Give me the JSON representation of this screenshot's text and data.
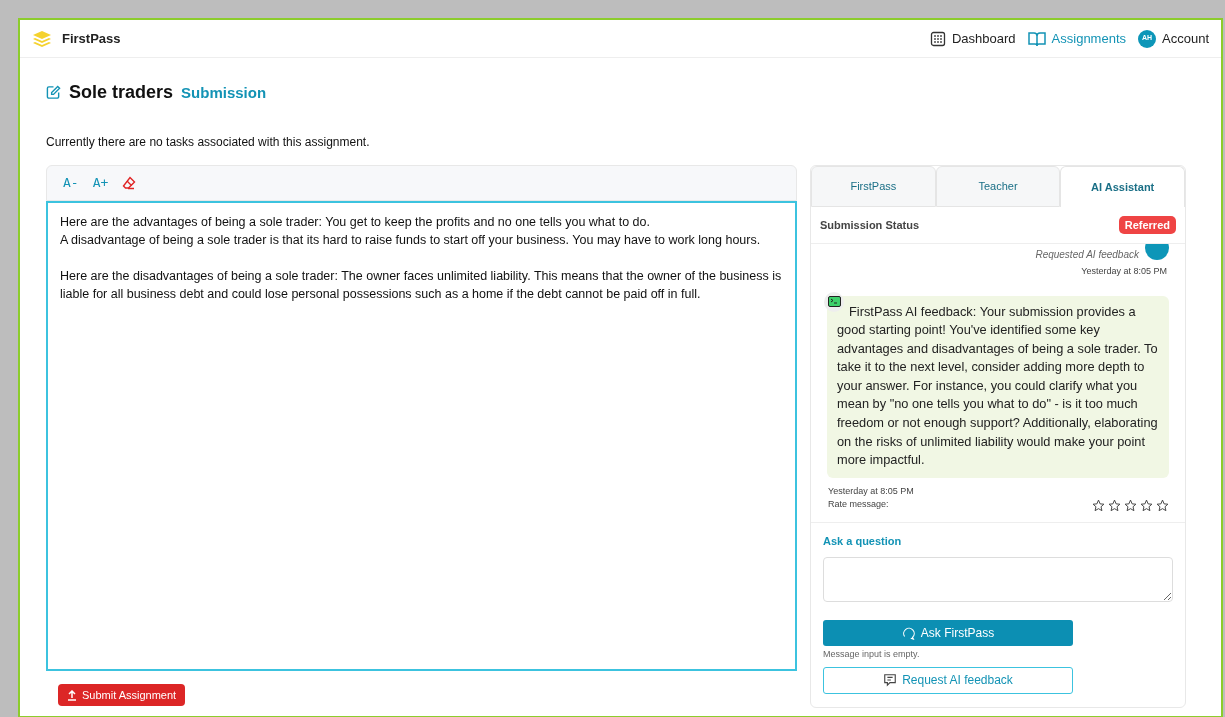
{
  "app": {
    "name": "FirstPass"
  },
  "nav": [
    {
      "label": "Dashboard",
      "kind": "grid",
      "selected": false
    },
    {
      "label": "Assignments",
      "kind": "book",
      "selected": true
    },
    {
      "label": "Account",
      "kind": "avatar",
      "initials": "AH",
      "selected": false
    }
  ],
  "page": {
    "title": "Sole traders",
    "subtitle": "Submission",
    "note": "Currently there are no tasks associated with this assignment."
  },
  "toolbar": [
    {
      "label": "A-",
      "kind": "text"
    },
    {
      "label": "A+",
      "kind": "text"
    },
    {
      "kind": "eraser"
    }
  ],
  "editor": {
    "paragraphs": [
      "Here are the advantages of being a sole trader: You get to keep the profits and no one tells you what to do.\nA disadvantage of being a sole trader is that its hard to raise funds to start off your business. You may have to work long hours.",
      "Here are the disadvantages of being a sole trader: The owner faces unlimited liability. This means that the owner of the business is liable for all business debt and could lose personal possessions such as a home if the debt cannot be paid off in full."
    ]
  },
  "submit_button": "Submit Assignment",
  "tabs": [
    {
      "label": "FirstPass",
      "selected": false
    },
    {
      "label": "Teacher",
      "selected": false
    },
    {
      "label": "AI Assistant",
      "selected": true
    }
  ],
  "status": {
    "label": "Submission Status",
    "badge": "Referred"
  },
  "chat": {
    "request": {
      "text": "Requested AI feedback",
      "time": "Yesterday at 8:05 PM"
    },
    "reply": {
      "text": "FirstPass AI feedback: Your submission provides a good starting point! You've identified some key advantages and disadvantages of being a sole trader. To take it to the next level, consider adding more depth to your answer. For instance, you could clarify what you mean by \"no one tells you what to do\" - is it too much freedom or not enough support? Additionally, elaborating on the risks of unlimited liability would make your point more impactful.",
      "time": "Yesterday at 8:05 PM",
      "rate_label": "Rate message:",
      "stars": 0
    }
  },
  "question": {
    "label": "Ask a question",
    "ask_button": "Ask FirstPass",
    "hint": "Message input is empty.",
    "feedback_button": "Request AI feedback"
  }
}
